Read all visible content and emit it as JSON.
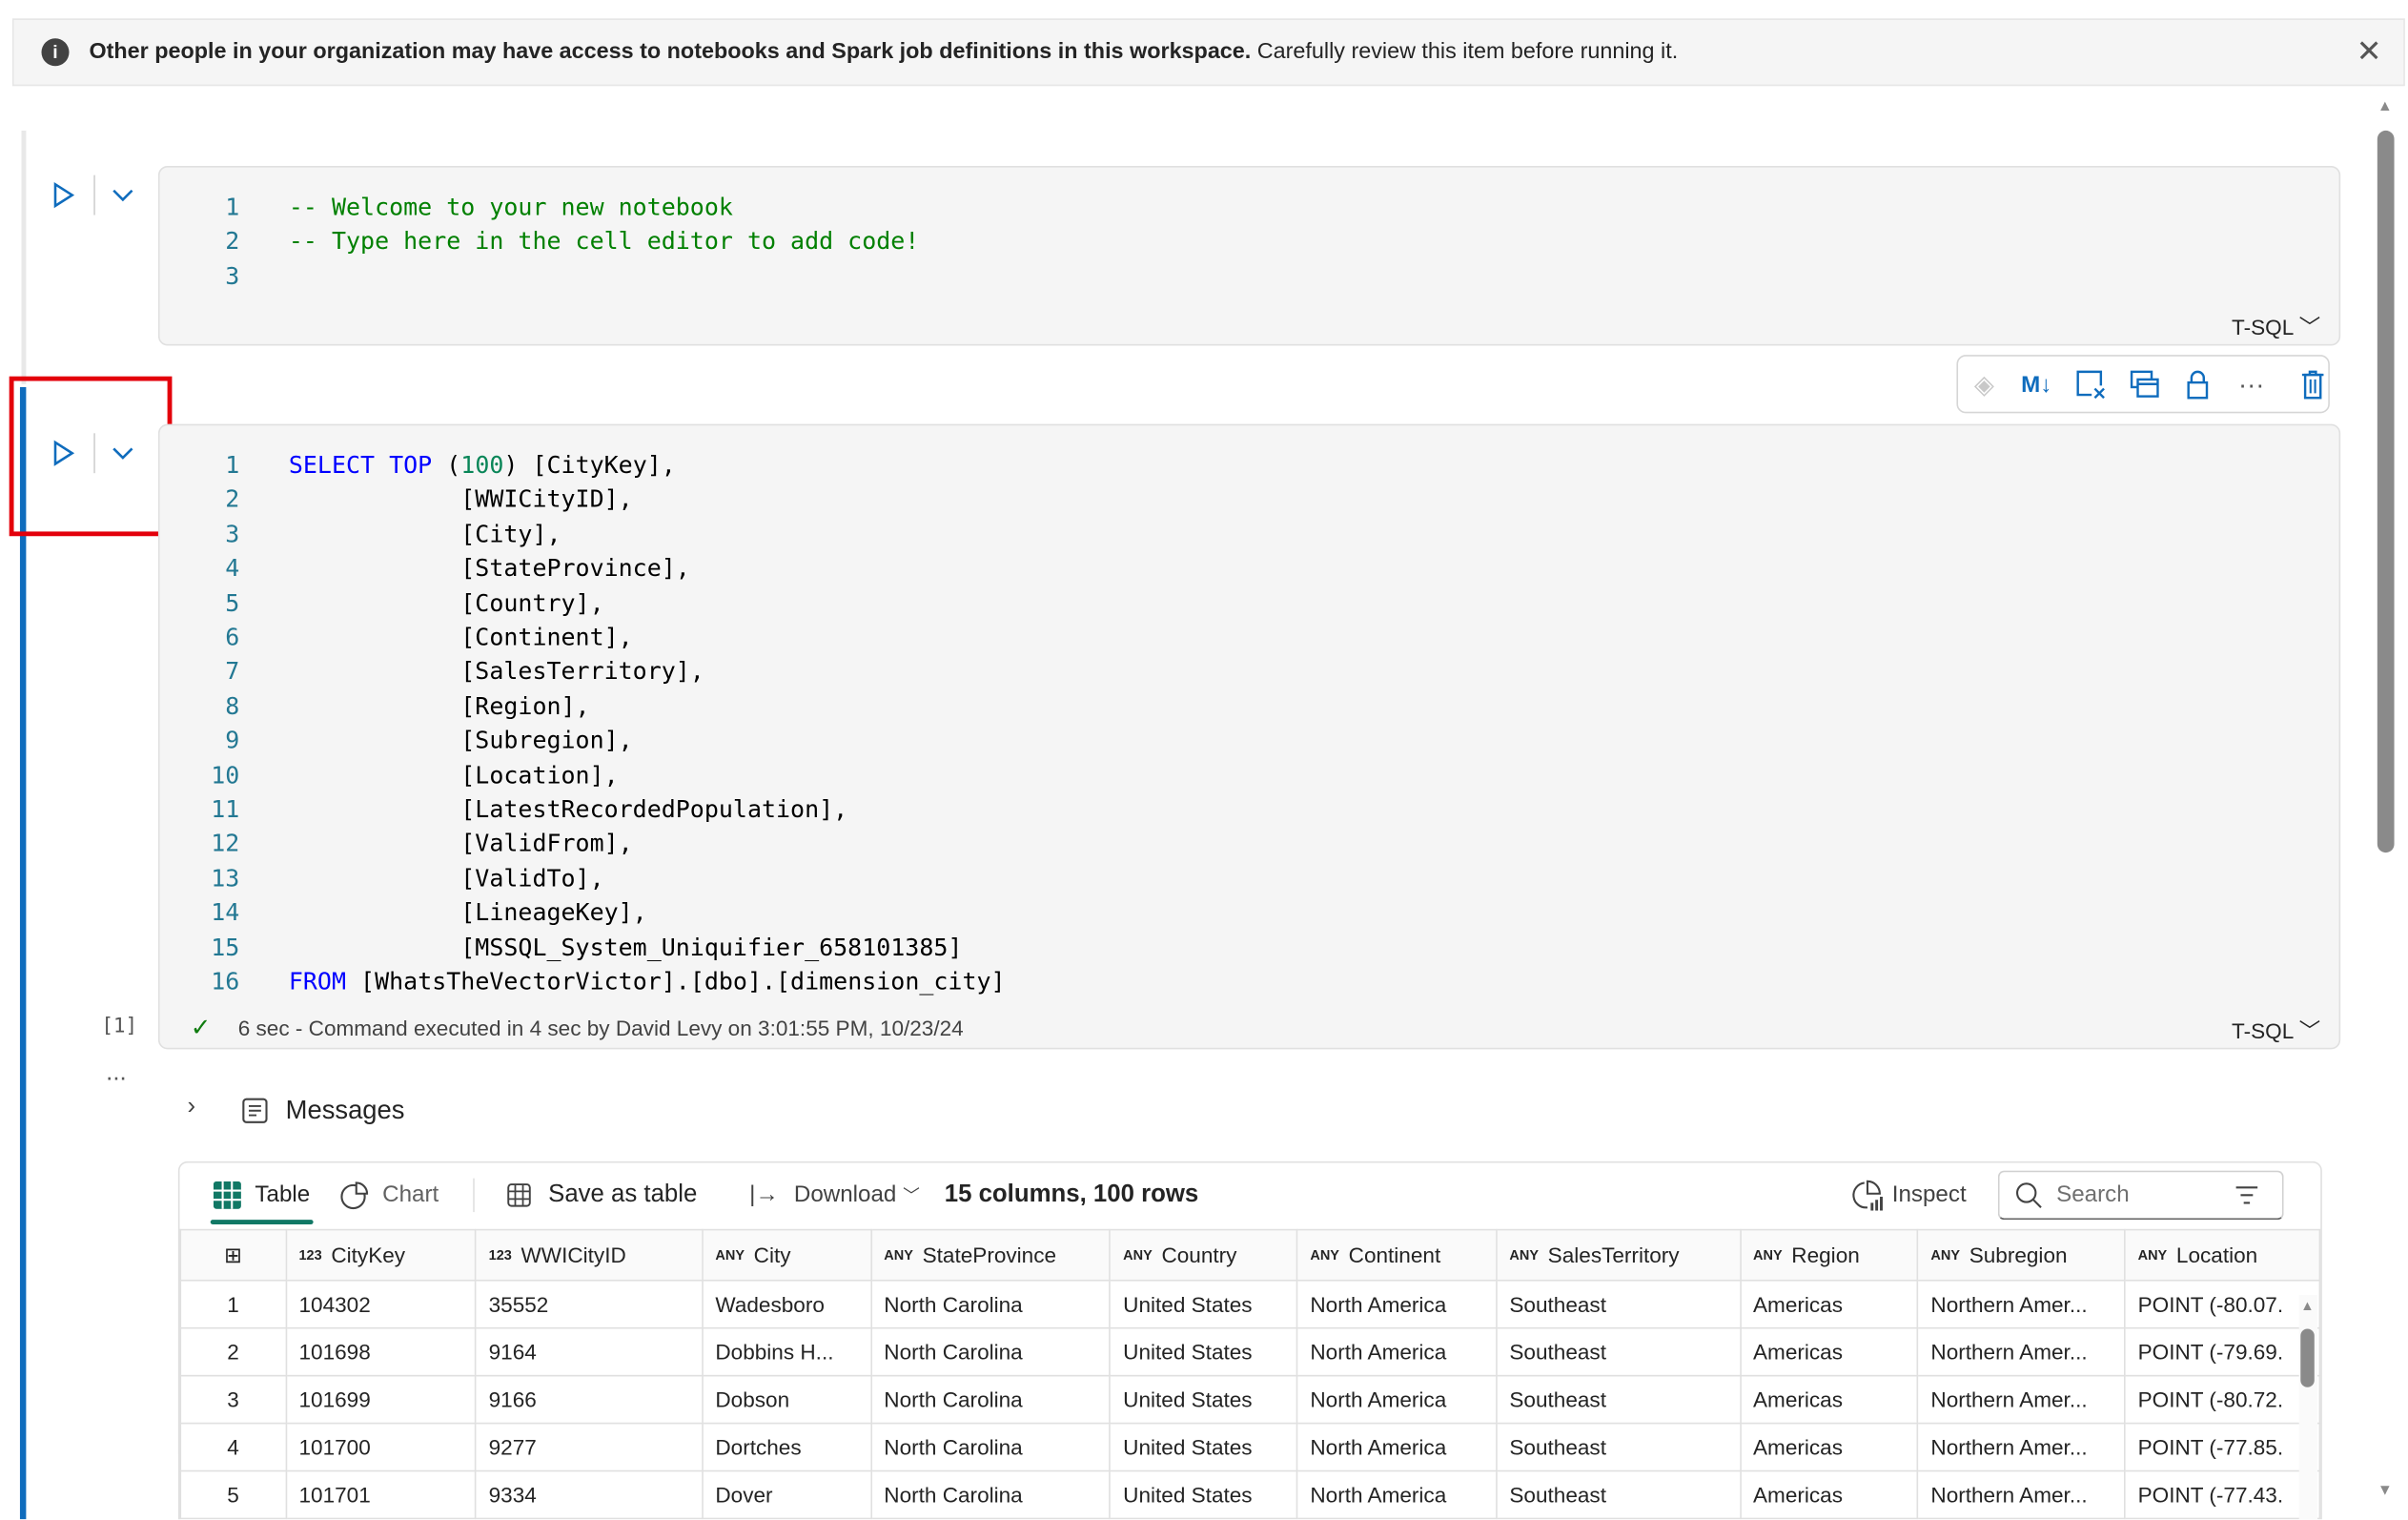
{
  "banner": {
    "bold_text": "Other people in your organization may have access to notebooks and Spark job definitions in this workspace.",
    "text": "Carefully review this item before running it.",
    "info_icon": "info-icon",
    "close_icon": "close-icon"
  },
  "cell1": {
    "language": "T-SQL",
    "lines": [
      [
        {
          "t": "-- Welcome to your new notebook",
          "c": "cm"
        }
      ],
      [
        {
          "t": "-- Type here in the cell editor to add code!",
          "c": "cm"
        }
      ],
      []
    ]
  },
  "cell_toolbar": {
    "icons": [
      "copilot-icon",
      "markdown-toggle-icon",
      "clear-output-icon",
      "duplicate-cell-icon",
      "lock-icon",
      "more-options-icon",
      "delete-icon"
    ]
  },
  "cell2": {
    "language": "T-SQL",
    "execution_count": "[1]",
    "status": "6 sec - Command executed in 4 sec by David Levy on 3:01:55 PM, 10/23/24",
    "more": "...",
    "lines": [
      [
        {
          "t": "SELECT TOP ",
          "c": "kw"
        },
        {
          "t": "(",
          "c": "pl"
        },
        {
          "t": "100",
          "c": "nm"
        },
        {
          "t": ") [CityKey],",
          "c": "pl"
        }
      ],
      [
        {
          "t": "            [WWICityID],",
          "c": "pl"
        }
      ],
      [
        {
          "t": "            [City],",
          "c": "pl"
        }
      ],
      [
        {
          "t": "            [StateProvince],",
          "c": "pl"
        }
      ],
      [
        {
          "t": "            [Country],",
          "c": "pl"
        }
      ],
      [
        {
          "t": "            [Continent],",
          "c": "pl"
        }
      ],
      [
        {
          "t": "            [SalesTerritory],",
          "c": "pl"
        }
      ],
      [
        {
          "t": "            [Region],",
          "c": "pl"
        }
      ],
      [
        {
          "t": "            [Subregion],",
          "c": "pl"
        }
      ],
      [
        {
          "t": "            [Location],",
          "c": "pl"
        }
      ],
      [
        {
          "t": "            [LatestRecordedPopulation],",
          "c": "pl"
        }
      ],
      [
        {
          "t": "            [ValidFrom],",
          "c": "pl"
        }
      ],
      [
        {
          "t": "            [ValidTo],",
          "c": "pl"
        }
      ],
      [
        {
          "t": "            [LineageKey],",
          "c": "pl"
        }
      ],
      [
        {
          "t": "            [MSSQL_System_Uniquifier_658101385]",
          "c": "pl"
        }
      ],
      [
        {
          "t": "FROM ",
          "c": "kw"
        },
        {
          "t": "[WhatsTheVectorVictor].[dbo].[dimension_city]",
          "c": "pl"
        }
      ]
    ]
  },
  "messages": {
    "label": "Messages"
  },
  "results": {
    "tab_table": "Table",
    "tab_chart": "Chart",
    "save_as_table": "Save as table",
    "download": "Download",
    "summary": "15 columns, 100 rows",
    "inspect": "Inspect",
    "search_placeholder": "Search",
    "accent": "#117865",
    "columns": [
      {
        "type": "123",
        "name": "CityKey"
      },
      {
        "type": "123",
        "name": "WWICityID"
      },
      {
        "type": "ANY",
        "name": "City"
      },
      {
        "type": "ANY",
        "name": "StateProvince"
      },
      {
        "type": "ANY",
        "name": "Country"
      },
      {
        "type": "ANY",
        "name": "Continent"
      },
      {
        "type": "ANY",
        "name": "SalesTerritory"
      },
      {
        "type": "ANY",
        "name": "Region"
      },
      {
        "type": "ANY",
        "name": "Subregion"
      },
      {
        "type": "ANY",
        "name": "Location"
      }
    ],
    "rows": [
      [
        "1",
        "104302",
        "35552",
        "Wadesboro",
        "North Carolina",
        "United States",
        "North America",
        "Southeast",
        "Americas",
        "Northern Amer...",
        "POINT (-80.07."
      ],
      [
        "2",
        "101698",
        "9164",
        "Dobbins H...",
        "North Carolina",
        "United States",
        "North America",
        "Southeast",
        "Americas",
        "Northern Amer...",
        "POINT (-79.69."
      ],
      [
        "3",
        "101699",
        "9166",
        "Dobson",
        "North Carolina",
        "United States",
        "North America",
        "Southeast",
        "Americas",
        "Northern Amer...",
        "POINT (-80.72."
      ],
      [
        "4",
        "101700",
        "9277",
        "Dortches",
        "North Carolina",
        "United States",
        "North America",
        "Southeast",
        "Americas",
        "Northern Amer...",
        "POINT (-77.85."
      ],
      [
        "5",
        "101701",
        "9334",
        "Dover",
        "North Carolina",
        "United States",
        "North America",
        "Southeast",
        "Americas",
        "Northern Amer...",
        "POINT (-77.43."
      ]
    ]
  }
}
